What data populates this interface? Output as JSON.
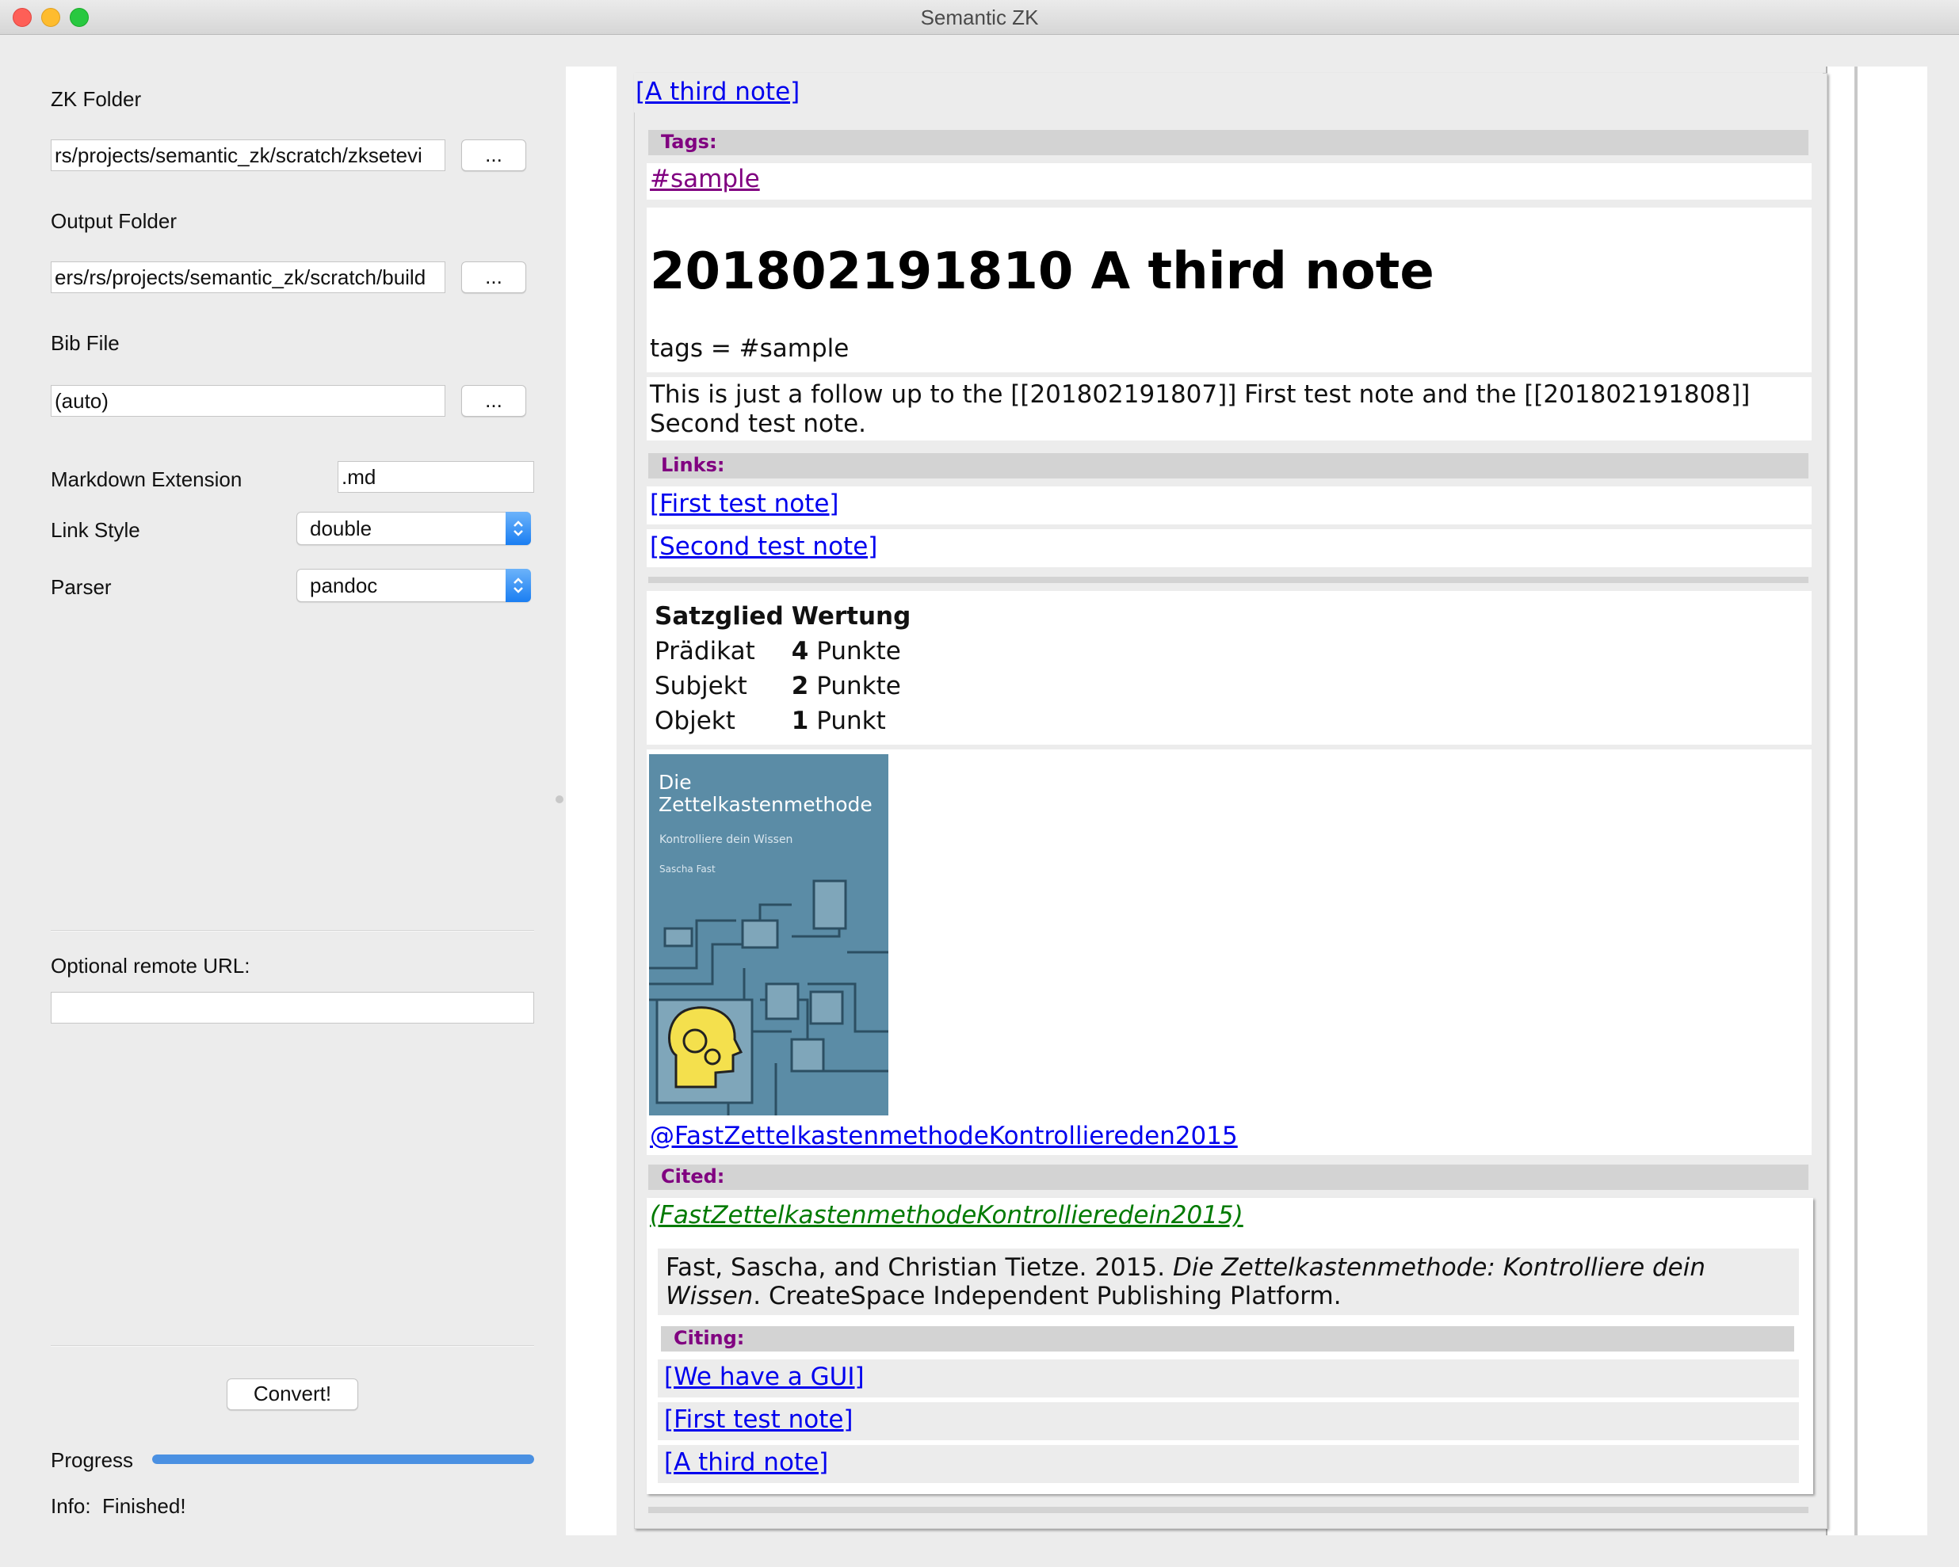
{
  "window": {
    "title": "Semantic ZK"
  },
  "left": {
    "zk_folder": {
      "label": "ZK Folder",
      "value": "rs/projects/semantic_zk/scratch/zksetevi",
      "browse": "..."
    },
    "output_folder": {
      "label": "Output Folder",
      "value": "ers/rs/projects/semantic_zk/scratch/build",
      "browse": "..."
    },
    "bib_file": {
      "label": "Bib File",
      "value": "(auto)",
      "browse": "..."
    },
    "markdown_extension": {
      "label": "Markdown Extension",
      "value": ".md"
    },
    "link_style": {
      "label": "Link Style",
      "value": "double"
    },
    "parser": {
      "label": "Parser",
      "value": "pandoc"
    },
    "remote_url": {
      "label": "Optional remote URL:",
      "value": ""
    },
    "convert_label": "Convert!",
    "progress": {
      "label": "Progress",
      "value": 1.0
    },
    "info": {
      "label": "Info:",
      "value": "Finished!"
    }
  },
  "note": {
    "top_link": "[A third note]",
    "tags_header": "Tags:",
    "tag": "#sample",
    "title": "201802191810 A third note",
    "tags_line": "tags = #sample",
    "body_line1": "This is just a follow up to the [[201802191807]] First test note and the [[201802191808]]",
    "body_line2": "Second test note.",
    "links_header": "Links:",
    "links": [
      "[First test note]",
      "[Second test note]"
    ],
    "table": {
      "headers": [
        "Satzglied",
        "Wertung"
      ],
      "rows": [
        {
          "part": "Prädikat",
          "num": "4",
          "unit": "Punkte"
        },
        {
          "part": "Subjekt",
          "num": "2",
          "unit": "Punkte"
        },
        {
          "part": "Objekt",
          "num": "1",
          "unit": "Punkt"
        }
      ]
    },
    "cover": {
      "title_line1": "Die",
      "title_line2": "Zettelkastenmethode",
      "subtitle": "Kontrolliere dein Wissen",
      "author": "Sascha Fast"
    },
    "citation_link": "@FastZettelkastenmethodeKontrolliereden2015",
    "cited_header": "Cited:",
    "cited_link": "(FastZettelkastenmethodeKontrollieredein2015)",
    "reference": {
      "prefix": "Fast, Sascha, and Christian Tietze. 2015. ",
      "title_italic1": "Die Zettelkastenmethode: Kontrolliere dein",
      "title_italic2": "Wissen",
      "suffix": ". CreateSpace Independent Publishing Platform."
    },
    "citing_header": "Citing:",
    "citing_links": [
      "[We have a GUI]",
      "[First test note]",
      "[A third note]"
    ]
  }
}
